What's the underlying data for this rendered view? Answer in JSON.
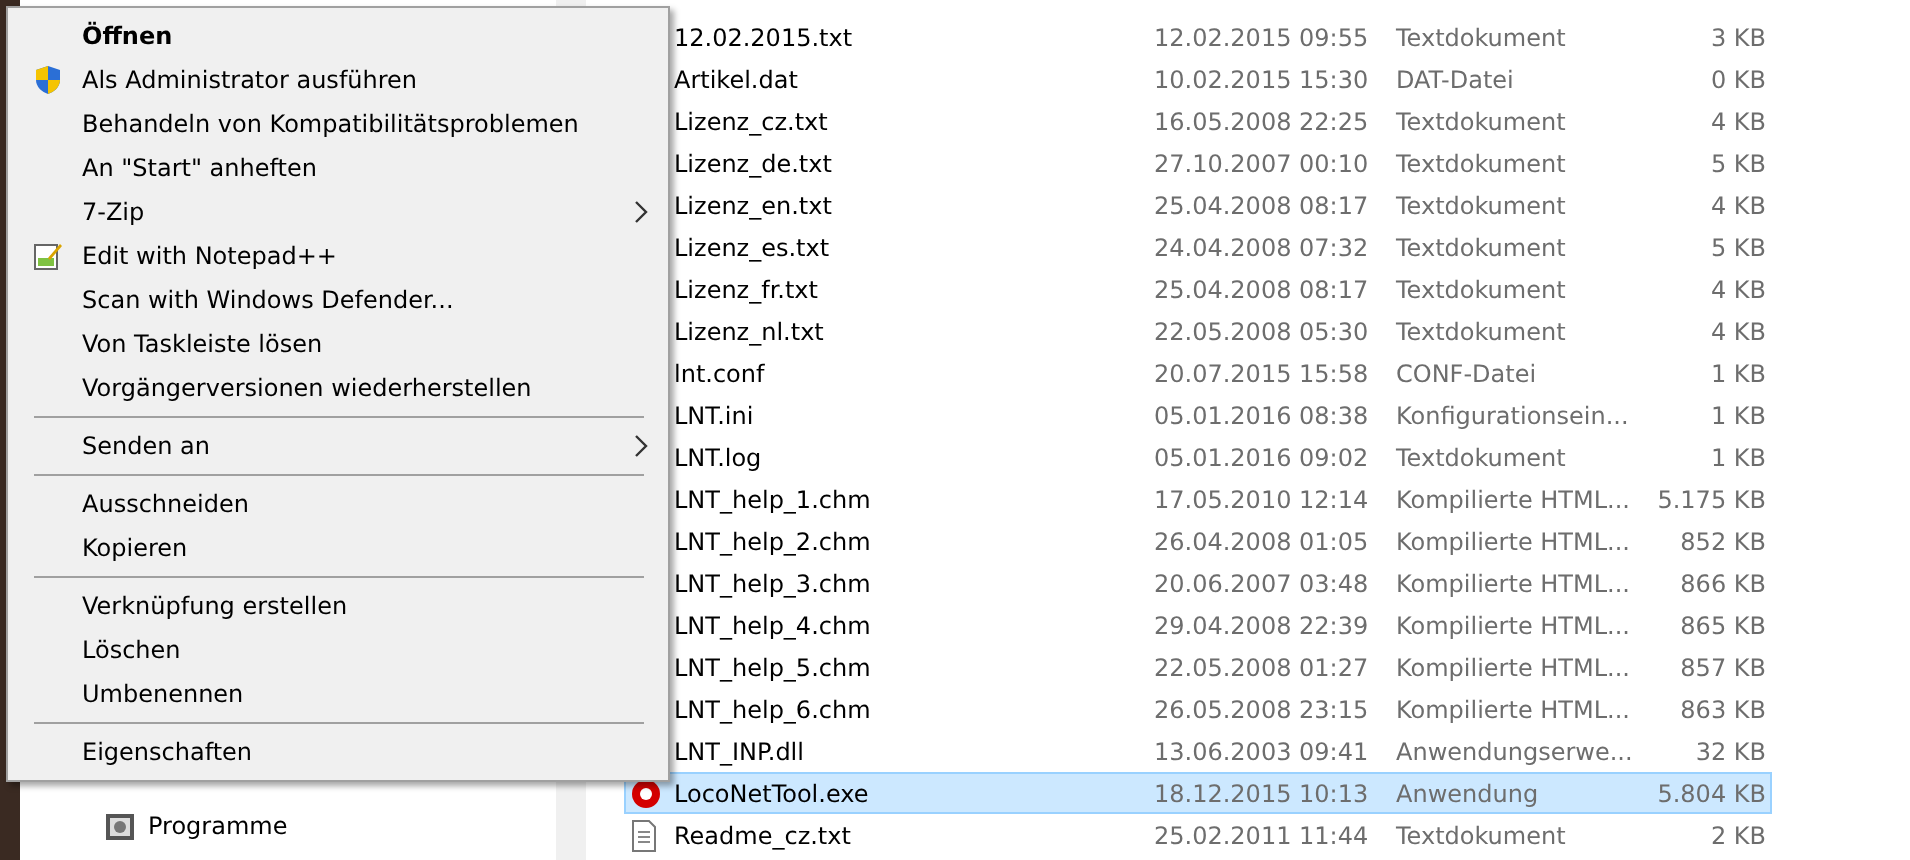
{
  "context_menu": {
    "items": [
      {
        "kind": "item",
        "label": "Öffnen",
        "default": true
      },
      {
        "kind": "admin",
        "label": "Als Administrator ausführen"
      },
      {
        "kind": "item",
        "label": "Behandeln von Kompatibilitätsproblemen"
      },
      {
        "kind": "item",
        "label": "An \"Start\" anheften"
      },
      {
        "kind": "item",
        "label": "7-Zip",
        "submenu": true
      },
      {
        "kind": "notepad",
        "label": "Edit with Notepad++"
      },
      {
        "kind": "item",
        "label": "Scan with Windows Defender..."
      },
      {
        "kind": "item",
        "label": "Von Taskleiste lösen"
      },
      {
        "kind": "item",
        "label": "Vorgängerversionen wiederherstellen"
      },
      {
        "kind": "separator"
      },
      {
        "kind": "item",
        "label": "Senden an",
        "submenu": true
      },
      {
        "kind": "separator"
      },
      {
        "kind": "item",
        "label": "Ausschneiden"
      },
      {
        "kind": "item",
        "label": "Kopieren"
      },
      {
        "kind": "separator"
      },
      {
        "kind": "item",
        "label": "Verknüpfung erstellen"
      },
      {
        "kind": "item",
        "label": "Löschen"
      },
      {
        "kind": "item",
        "label": "Umbenennen"
      },
      {
        "kind": "separator"
      },
      {
        "kind": "item",
        "label": "Eigenschaften"
      }
    ]
  },
  "navigation_pane": {
    "items": [
      {
        "label": "Programme"
      }
    ]
  },
  "file_list": {
    "rows": [
      {
        "name": "12.02.2015.txt",
        "date": "12.02.2015 09:55",
        "type": "Textdokument",
        "size": "3 KB",
        "selected": false
      },
      {
        "name": "Artikel.dat",
        "date": "10.02.2015 15:30",
        "type": "DAT-Datei",
        "size": "0 KB",
        "selected": false
      },
      {
        "name": "Lizenz_cz.txt",
        "date": "16.05.2008 22:25",
        "type": "Textdokument",
        "size": "4 KB",
        "selected": false
      },
      {
        "name": "Lizenz_de.txt",
        "date": "27.10.2007 00:10",
        "type": "Textdokument",
        "size": "5 KB",
        "selected": false
      },
      {
        "name": "Lizenz_en.txt",
        "date": "25.04.2008 08:17",
        "type": "Textdokument",
        "size": "4 KB",
        "selected": false
      },
      {
        "name": "Lizenz_es.txt",
        "date": "24.04.2008 07:32",
        "type": "Textdokument",
        "size": "5 KB",
        "selected": false
      },
      {
        "name": "Lizenz_fr.txt",
        "date": "25.04.2008 08:17",
        "type": "Textdokument",
        "size": "4 KB",
        "selected": false
      },
      {
        "name": "Lizenz_nl.txt",
        "date": "22.05.2008 05:30",
        "type": "Textdokument",
        "size": "4 KB",
        "selected": false
      },
      {
        "name": "lnt.conf",
        "date": "20.07.2015 15:58",
        "type": "CONF-Datei",
        "size": "1 KB",
        "selected": false
      },
      {
        "name": "LNT.ini",
        "date": "05.01.2016 08:38",
        "type": "Konfigurationsein...",
        "size": "1 KB",
        "selected": false
      },
      {
        "name": "LNT.log",
        "date": "05.01.2016 09:02",
        "type": "Textdokument",
        "size": "1 KB",
        "selected": false
      },
      {
        "name": "LNT_help_1.chm",
        "date": "17.05.2010 12:14",
        "type": "Kompilierte HTML...",
        "size": "5.175 KB",
        "selected": false
      },
      {
        "name": "LNT_help_2.chm",
        "date": "26.04.2008 01:05",
        "type": "Kompilierte HTML...",
        "size": "852 KB",
        "selected": false
      },
      {
        "name": "LNT_help_3.chm",
        "date": "20.06.2007 03:48",
        "type": "Kompilierte HTML...",
        "size": "866 KB",
        "selected": false
      },
      {
        "name": "LNT_help_4.chm",
        "date": "29.04.2008 22:39",
        "type": "Kompilierte HTML...",
        "size": "865 KB",
        "selected": false
      },
      {
        "name": "LNT_help_5.chm",
        "date": "22.05.2008 01:27",
        "type": "Kompilierte HTML...",
        "size": "857 KB",
        "selected": false
      },
      {
        "name": "LNT_help_6.chm",
        "date": "26.05.2008 23:15",
        "type": "Kompilierte HTML...",
        "size": "863 KB",
        "selected": false
      },
      {
        "name": "LNT_INP.dll",
        "date": "13.06.2003 09:41",
        "type": "Anwendungserwe...",
        "size": "32 KB",
        "selected": false
      },
      {
        "name": "LocoNetTool.exe",
        "date": "18.12.2015 10:13",
        "type": "Anwendung",
        "size": "5.804 KB",
        "selected": true,
        "kind": "application"
      },
      {
        "name": "Readme_cz.txt",
        "date": "25.02.2011 11:44",
        "type": "Textdokument",
        "size": "2 KB",
        "selected": false,
        "kind": "document"
      }
    ]
  }
}
